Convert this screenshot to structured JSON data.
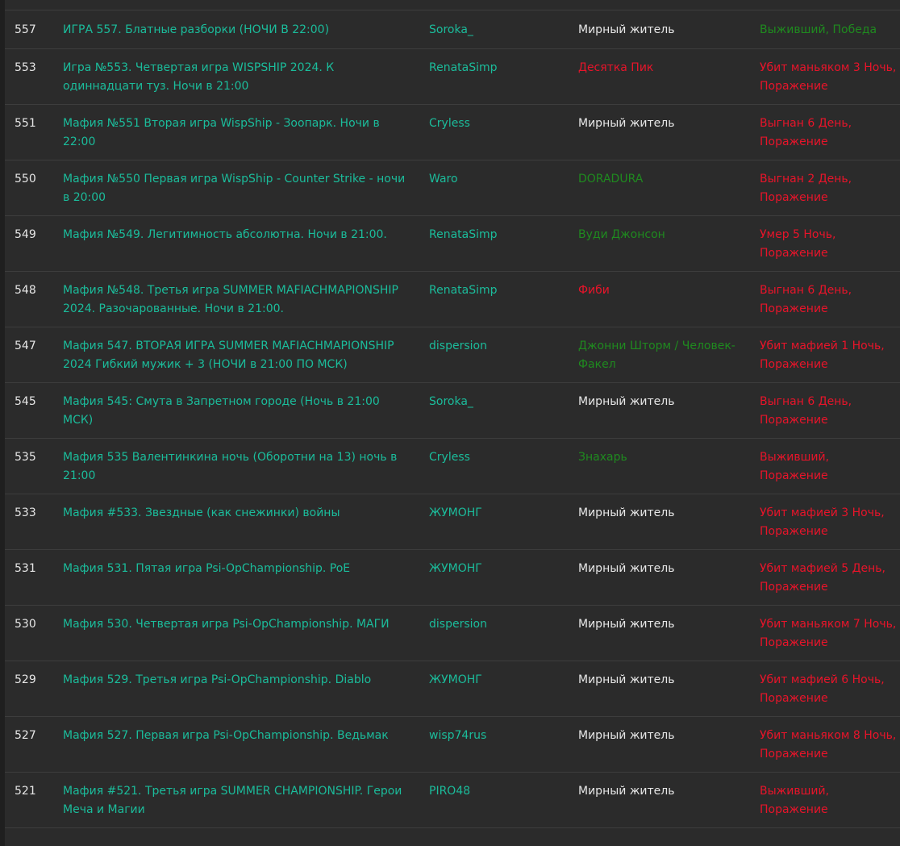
{
  "games": [
    {
      "num": "557",
      "title": "ИГРА 557. Блатные разборки (НОЧИ В 22:00)",
      "host": "Soroka_",
      "role": "Мирный житель",
      "role_type": "town",
      "result": "Выживший, Победа",
      "result_type": "win"
    },
    {
      "num": "553",
      "title": "Игра №553. Четвертая игра WISPSHIP 2024. К одиннадцати туз. Ночи в 21:00",
      "host": "RenataSimp",
      "role": "Десятка Пик",
      "role_type": "red",
      "result": "Убит маньяком 3 Ночь, Поражение",
      "result_type": "loss"
    },
    {
      "num": "551",
      "title": "Мафия №551 Вторая игра WispShip - Зоопарк. Ночи в 22:00",
      "host": "Cryless",
      "role": "Мирный житель",
      "role_type": "town",
      "result": "Выгнан 6 День, Поражение",
      "result_type": "loss"
    },
    {
      "num": "550",
      "title": "Мафия №550 Первая игра WispShip - Counter Strike - ночи в 20:00",
      "host": "Waro",
      "role": "DORADURA",
      "role_type": "green",
      "result": "Выгнан 2 День, Поражение",
      "result_type": "loss"
    },
    {
      "num": "549",
      "title": "Мафия №549. Легитимность абсолютна. Ночи в 21:00.",
      "host": "RenataSimp",
      "role": "Вуди Джонсон",
      "role_type": "green",
      "result": "Умер 5 Ночь, Поражение",
      "result_type": "loss"
    },
    {
      "num": "548",
      "title": "Мафия №548. Третья игра SUMMER MAFIACHMAPIONSHIP 2024. Разочарованные. Ночи в 21:00.",
      "host": "RenataSimp",
      "role": "Фиби",
      "role_type": "red",
      "result": "Выгнан 6 День, Поражение",
      "result_type": "loss"
    },
    {
      "num": "547",
      "title": "Мафия 547. ВТОРАЯ ИГРА SUMMER MAFIACHMAPIONSHIP 2024 Гибкий мужик + 3 (НОЧИ в 21:00 ПО МСК)",
      "host": "dispersion",
      "role": "Джонни Шторм / Человек-Факел",
      "role_type": "green",
      "result": "Убит мафией 1 Ночь, Поражение",
      "result_type": "loss"
    },
    {
      "num": "545",
      "title": "Мафия 545: Смута в Запретном городе (Ночь в 21:00 МСК)",
      "host": "Soroka_",
      "role": "Мирный житель",
      "role_type": "town",
      "result": "Выгнан 6 День, Поражение",
      "result_type": "loss"
    },
    {
      "num": "535",
      "title": "Мафия 535 Валентинкина ночь (Оборотни на 13) ночь в 21:00",
      "host": "Cryless",
      "role": "Знахарь",
      "role_type": "green",
      "result": "Выживший, Поражение",
      "result_type": "loss"
    },
    {
      "num": "533",
      "title": "Мафия #533. Звездные (как снежинки) войны",
      "host": "ЖУМОНГ",
      "role": "Мирный житель",
      "role_type": "town",
      "result": "Убит мафией 3 Ночь, Поражение",
      "result_type": "loss"
    },
    {
      "num": "531",
      "title": "Мафия 531. Пятая игра Psi-OpChampionship. PoE",
      "host": "ЖУМОНГ",
      "role": "Мирный житель",
      "role_type": "town",
      "result": "Убит мафией 5 День, Поражение",
      "result_type": "loss"
    },
    {
      "num": "530",
      "title": "Мафия 530. Четвертая игра Psi-OpChampionship. МАГИ",
      "host": "dispersion",
      "role": "Мирный житель",
      "role_type": "town",
      "result": "Убит маньяком 7 Ночь, Поражение",
      "result_type": "loss"
    },
    {
      "num": "529",
      "title": "Мафия 529. Третья игра Psi-OpChampionship. Diablo",
      "host": "ЖУМОНГ",
      "role": "Мирный житель",
      "role_type": "town",
      "result": "Убит мафией 6 Ночь, Поражение",
      "result_type": "loss"
    },
    {
      "num": "527",
      "title": "Мафия 527. Первая игра Psi-OpChampionship. Ведьмак",
      "host": "wisp74rus",
      "role": "Мирный житель",
      "role_type": "town",
      "result": "Убит маньяком 8 Ночь, Поражение",
      "result_type": "loss"
    },
    {
      "num": "521",
      "title": "Мафия #521. Третья игра SUMMER CHAMPIONSHIP. Герои Меча и Магии",
      "host": "PIRO48",
      "role": "Мирный житель",
      "role_type": "town",
      "result": "Выживший, Поражение",
      "result_type": "loss"
    }
  ],
  "colors": {
    "link": "#1bbc9b",
    "loss": "#e8142a",
    "win": "#1f8a1f",
    "text": "#e6e6e6"
  }
}
